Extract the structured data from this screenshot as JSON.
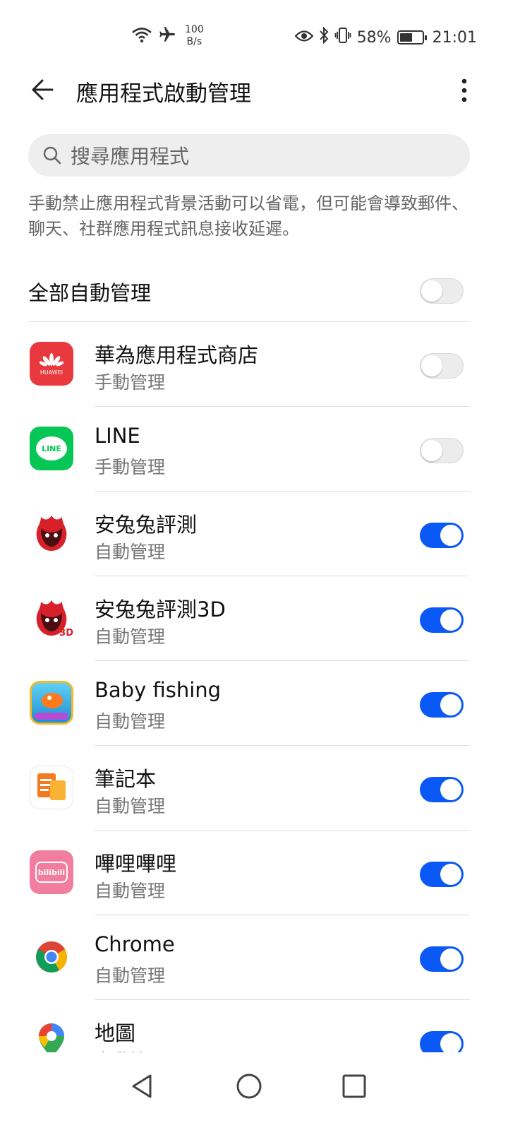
{
  "status_bar": {
    "net_speed_value": "100",
    "net_speed_unit": "B/s",
    "battery_percent": "58%",
    "battery_level": 0.58,
    "time": "21:01"
  },
  "header": {
    "title": "應用程式啟動管理"
  },
  "search": {
    "placeholder": "搜尋應用程式"
  },
  "description": "手動禁止應用程式背景活動可以省電，但可能會導致郵件、聊天、社群應用程式訊息接收延遲。",
  "all_auto": {
    "label": "全部自動管理",
    "enabled": false
  },
  "apps": [
    {
      "name": "華為應用程式商店",
      "status": "手動管理",
      "enabled": false,
      "icon": "huawei-appgallery-icon",
      "icon_text": "HUAWEI",
      "color": "#e8393f"
    },
    {
      "name": "LINE",
      "status": "手動管理",
      "enabled": false,
      "icon": "line-icon",
      "icon_text": "LINE",
      "color": "#06c755"
    },
    {
      "name": "安兔兔評測",
      "status": "自動管理",
      "enabled": true,
      "icon": "antutu-icon",
      "color": "#d8202b"
    },
    {
      "name": "安兔兔評測3D",
      "status": "自動管理",
      "enabled": true,
      "icon": "antutu-3d-icon",
      "icon_text": "3D",
      "color": "#d8202b"
    },
    {
      "name": "Baby fishing",
      "status": "自動管理",
      "enabled": true,
      "icon": "baby-fishing-icon",
      "color": "#27a6e0"
    },
    {
      "name": "筆記本",
      "status": "自動管理",
      "enabled": true,
      "icon": "notepad-icon",
      "color": "#f47a20"
    },
    {
      "name": "嗶哩嗶哩",
      "status": "自動管理",
      "enabled": true,
      "icon": "bilibili-icon",
      "icon_text": "bilibili",
      "color": "#f17ea0"
    },
    {
      "name": "Chrome",
      "status": "自動管理",
      "enabled": true,
      "icon": "chrome-icon",
      "color": "#4285f4"
    },
    {
      "name": "地圖",
      "status": "自動管理",
      "enabled": true,
      "icon": "maps-icon",
      "color": "#34a853"
    }
  ],
  "colors": {
    "toggle_on": "#0a59f7",
    "toggle_off": "#ececec"
  }
}
